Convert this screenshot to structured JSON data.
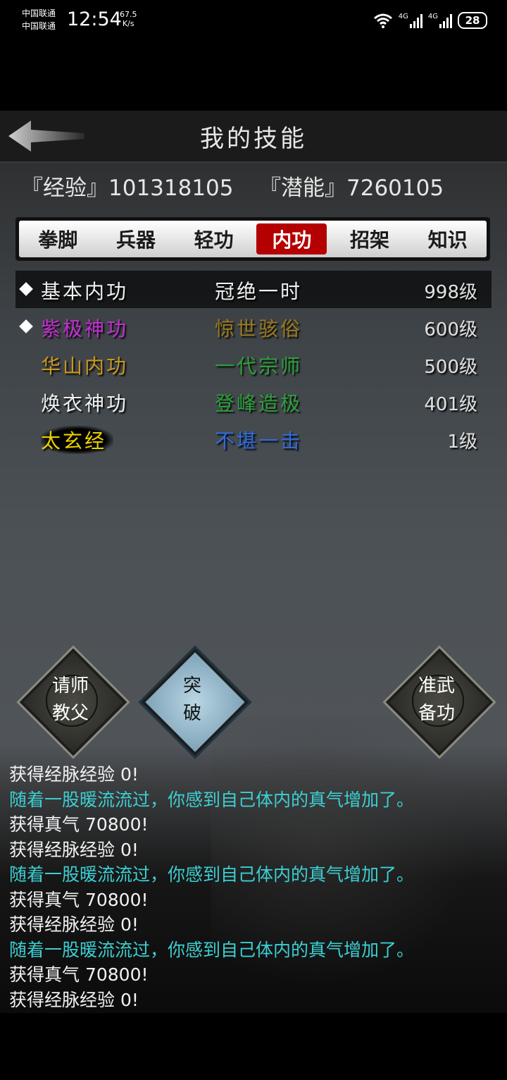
{
  "status_bar": {
    "carrier_1": "中国联通",
    "carrier_2": "中国联通",
    "time": "12:54",
    "speed_value": "67.5",
    "speed_unit": "K/s",
    "net_1": "4G",
    "net_2": "4G",
    "battery": "28"
  },
  "header": {
    "title": "我的技能"
  },
  "stats": {
    "exp_label": "『经验』",
    "exp_value": "101318105",
    "potential_label": "『潜能』",
    "potential_value": "7260105"
  },
  "tabs": [
    {
      "label": "拳脚"
    },
    {
      "label": "兵器"
    },
    {
      "label": "轻功"
    },
    {
      "label": "内功",
      "active": true
    },
    {
      "label": "招架"
    },
    {
      "label": "知识"
    }
  ],
  "skills": [
    {
      "name": "基本内功",
      "rank": "冠绝一时",
      "level": "998级",
      "name_color": "#f0f0f0",
      "rank_color": "#f0f0f0",
      "marked": true,
      "selected": true
    },
    {
      "name": "紫极神功",
      "rank": "惊世骇俗",
      "level": "600级",
      "name_color": "#c22fd0",
      "rank_color": "#9b7a1f",
      "marked": true,
      "selected": false
    },
    {
      "name": "华山内功",
      "rank": "一代宗师",
      "level": "500级",
      "name_color": "#c9981e",
      "rank_color": "#2f9e3c",
      "marked": false,
      "selected": false
    },
    {
      "name": "焕衣神功",
      "rank": "登峰造极",
      "level": "401级",
      "name_color": "#f0f0f0",
      "rank_color": "#2f9e3c",
      "marked": false,
      "selected": false
    },
    {
      "name": "太玄经",
      "rank": "不堪一击",
      "level": "1级",
      "name_color": "#e9d100",
      "rank_color": "#2f6be0",
      "marked": false,
      "selected": false
    }
  ],
  "actions": {
    "teacher": {
      "line1": "请师",
      "line2": "教父"
    },
    "breakthrough": {
      "line1": "突",
      "line2": "破"
    },
    "prepare": {
      "line1": "准武",
      "line2": "备功"
    }
  },
  "log": [
    {
      "text": "获得经脉经验 0!",
      "color": "white"
    },
    {
      "text": "随着一股暖流流过，你感到自己体内的真气增加了。",
      "color": "cyan"
    },
    {
      "text": "获得真气 70800!",
      "color": "white"
    },
    {
      "text": "获得经脉经验 0!",
      "color": "white"
    },
    {
      "text": "随着一股暖流流过，你感到自己体内的真气增加了。",
      "color": "cyan"
    },
    {
      "text": "获得真气 70800!",
      "color": "white"
    },
    {
      "text": "获得经脉经验 0!",
      "color": "white"
    },
    {
      "text": "随着一股暖流流过，你感到自己体内的真气增加了。",
      "color": "cyan"
    },
    {
      "text": "获得真气 70800!",
      "color": "white"
    },
    {
      "text": "获得经脉经验 0!",
      "color": "white"
    }
  ]
}
